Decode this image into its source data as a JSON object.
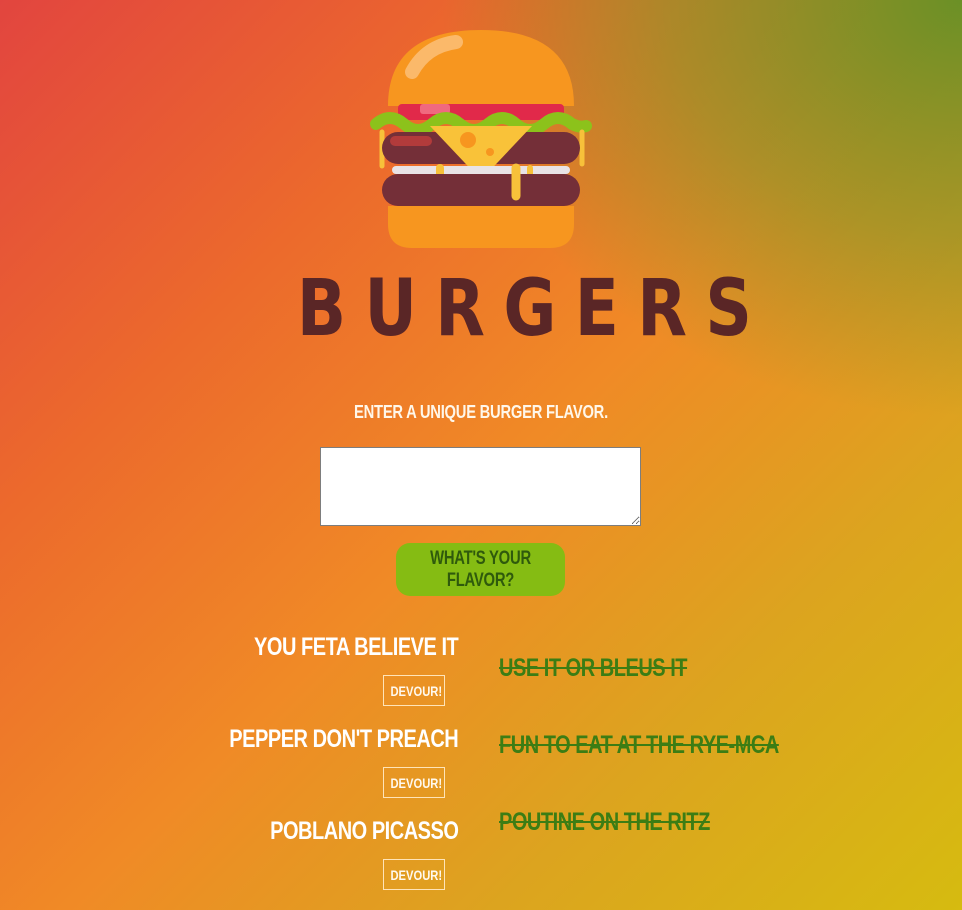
{
  "header": {
    "title": "BURGERS"
  },
  "form": {
    "prompt": "Enter a unique burger flavor.",
    "input_value": "",
    "submit_label": "What's your flavor?"
  },
  "uneaten": [
    {
      "name": "You Feta Believe It",
      "button_label": "Devour!"
    },
    {
      "name": "Pepper Don't Preach",
      "button_label": "Devour!"
    },
    {
      "name": "Poblano Picasso",
      "button_label": "Devour!"
    }
  ],
  "devoured": [
    {
      "name": "Use It or Bleus It"
    },
    {
      "name": "Fun to Eat at the Rye-MCA"
    },
    {
      "name": "Poutine on the Ritz"
    }
  ],
  "colors": {
    "title": "#5a2626",
    "submit_button": "#85bc13",
    "devoured_text": "#3c7d14"
  },
  "icons": {
    "logo": "burger-icon"
  }
}
